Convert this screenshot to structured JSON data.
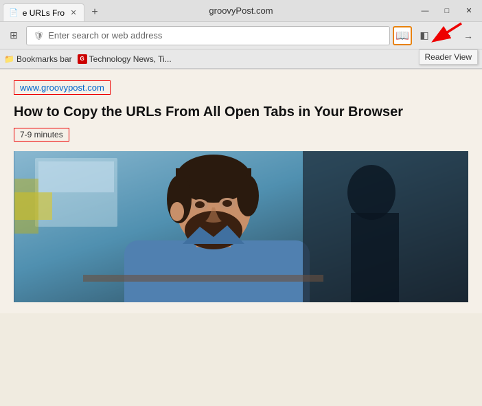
{
  "browser": {
    "title": "groovyPost.com",
    "tab": {
      "title": "e URLs Fro",
      "favicon": "📄"
    },
    "new_tab_label": "+",
    "window_controls": {
      "minimize": "—",
      "maximize": "□",
      "close": "✕"
    }
  },
  "navbar": {
    "address_placeholder": "Enter search or web address",
    "grid_icon": "⊞",
    "shield_icon": "🛡",
    "forward_icon": "→",
    "reader_view_tooltip": "Reader View",
    "reader_view_icon": "📖",
    "sidebar_icon": "◧",
    "more_icon": "⋯"
  },
  "bookmarks": {
    "bookmarks_bar_label": "Bookmarks bar",
    "bookmark_site": "Technology News, Ti..."
  },
  "page": {
    "site_url": "www.groovypost.com",
    "article_title": "How to Copy the URLs From All Open Tabs in Your Browser",
    "reading_time": "7-9 minutes"
  }
}
